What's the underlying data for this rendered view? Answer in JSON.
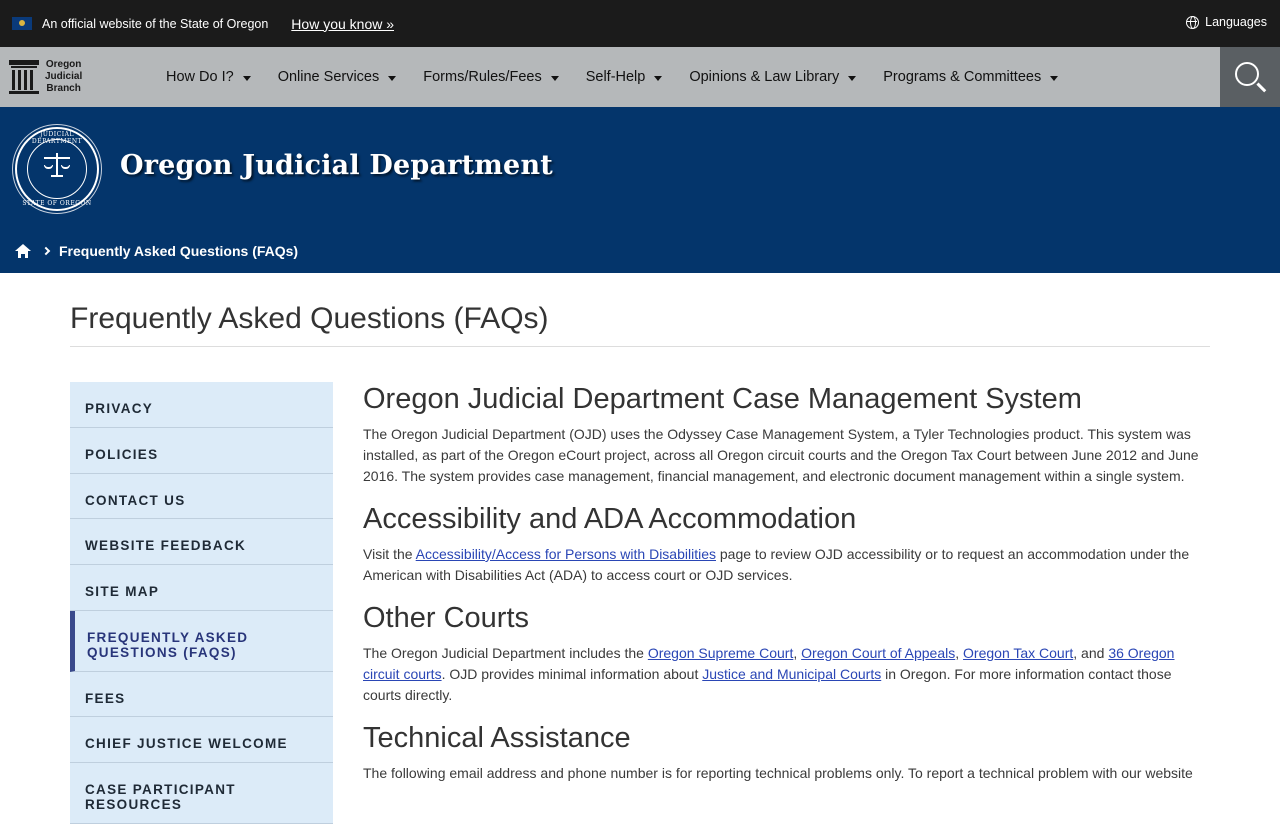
{
  "gov_banner": {
    "official_text": "An official website of the State of Oregon",
    "how_you_know": "How you know »",
    "languages": "Languages"
  },
  "nav": {
    "logo_lines": [
      "Oregon",
      "Judicial",
      "Branch"
    ],
    "items": [
      {
        "label": "How Do I?"
      },
      {
        "label": "Online Services"
      },
      {
        "label": "Forms/Rules/Fees"
      },
      {
        "label": "Self-Help"
      },
      {
        "label": "Opinions & Law Library"
      },
      {
        "label": "Programs & Committees"
      }
    ]
  },
  "hero": {
    "title": "Oregon Judicial Department",
    "seal_top_text": "JUDICIAL DEPARTMENT",
    "seal_bottom_text": "STATE OF OREGON"
  },
  "breadcrumb": {
    "current": "Frequently Asked Questions (FAQs)"
  },
  "page_title": "Frequently Asked Questions (FAQs)",
  "sidebar": {
    "items": [
      {
        "label": "Privacy"
      },
      {
        "label": "Policies"
      },
      {
        "label": "Contact Us"
      },
      {
        "label": "Website Feedback"
      },
      {
        "label": "Site Map"
      },
      {
        "label": "Frequently Asked Questions (FAQs)",
        "line1": "Frequently Asked",
        "line2": "Questions (FAQs)"
      },
      {
        "label": "Fees"
      },
      {
        "label": "Chief Justice Welcome"
      },
      {
        "label": "Case Participant Resources",
        "line1": "Case Participant",
        "line2": "Resources"
      }
    ]
  },
  "sections": {
    "cms": {
      "heading": "Oregon Judicial Department Case Management System",
      "body": "The Oregon Judicial Department (OJD) uses the Odyssey Case Management System, a Tyler Technologies product. This system was installed, as part of the Oregon eCourt project, across all Oregon circuit courts and the Oregon Tax Court between June 2012 and June 2016. The system provides case management, financial management, and electronic document management within a single system."
    },
    "ada": {
      "heading": "Accessibility and ADA Accommodation",
      "text1": "Visit the ",
      "link": "Accessibility/Access for Persons with Disabilities",
      "text2": " page to review OJD accessibility or to request an accommodation under the American with Disabilities Act (ADA) to access court or OJD services."
    },
    "other_courts": {
      "heading": "Other Courts",
      "text1": "The Oregon Judicial Department includes the ",
      "link1": "Oregon Supreme Court",
      "sep1": ", ",
      "link2": "Oregon Court of Appeals",
      "sep2": ", ",
      "link3": "Oregon Tax Court",
      "sep3": ", and ",
      "link4": "36 Oregon circuit courts",
      "text2": ". OJD provides minimal information about ",
      "link5": "Justice and Municipal Courts",
      "text3": " in Oregon. For more information contact those courts directly."
    },
    "tech": {
      "heading": "Technical Assistance",
      "body": "The following email address and phone number is for reporting technical problems only. To report a technical problem with our website"
    }
  },
  "colors": {
    "gov_bar": "#1b1b1b",
    "nav_bar": "#b5b8ba",
    "search_button": "#5a5f63",
    "hero": "#04356b",
    "sidebar_bg": "#dcebf8",
    "sidebar_active_border": "#3a4a8c",
    "link": "#2a46b5"
  }
}
